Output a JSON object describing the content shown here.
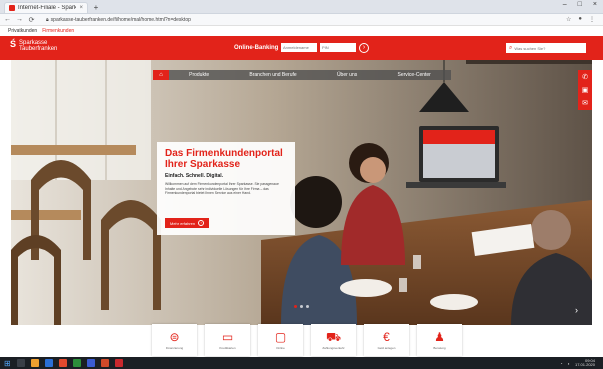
{
  "browser": {
    "tab_title": "Internet-Filiale - Sparkasse Taub",
    "tab_close": "×",
    "new_tab": "+",
    "url": "sparkasse-tauberfranken.de/fi/home/mal/home.html?n=desktop",
    "window_controls": [
      "–",
      "□",
      "×"
    ]
  },
  "bookmarks": [
    "Privatkunden",
    "Firmenkunden"
  ],
  "header": {
    "logo_mark": "Ś",
    "logo_line1": "Sparkasse",
    "logo_line2": "Tauberfranken",
    "banking_label": "Online-Banking",
    "login_placeholder": "Anmeldename",
    "pin_placeholder": "PIN",
    "search_placeholder": "Was suchen Sie?"
  },
  "nav": {
    "items": [
      "Produkte",
      "Branchen und Berufe",
      "Über uns",
      "Service-Center"
    ]
  },
  "hero": {
    "title_line1": "Das Firmenkundenportal",
    "title_line2": "Ihrer Sparkasse",
    "subtitle": "Einfach. Schnell. Digital.",
    "body": "Willkommen auf dem Firmenkundenportal Ihrer Sparkasse. Sie passgenaue Inhalte und Angebote sehr individuelle Lösungen für Ihre Firma – das Firmenkundenportal bietet Ihnen Service aus einer Hand.",
    "cta_label": "Mehr erfahren"
  },
  "tiles": [
    {
      "icon": "money-icon",
      "label": "Finanzierung"
    },
    {
      "icon": "card-icon",
      "label": "Kreditkarten"
    },
    {
      "icon": "laptop-icon",
      "label": "Online"
    },
    {
      "icon": "cart-icon",
      "label": "Zahlungsverkehr"
    },
    {
      "icon": "euro-icon",
      "label": "Geld anlegen"
    },
    {
      "icon": "person-icon",
      "label": "Beratung"
    }
  ],
  "taskbar": {
    "time": "09:04",
    "date": "17.01.2020"
  },
  "colors": {
    "brand_red": "#e2231a"
  }
}
